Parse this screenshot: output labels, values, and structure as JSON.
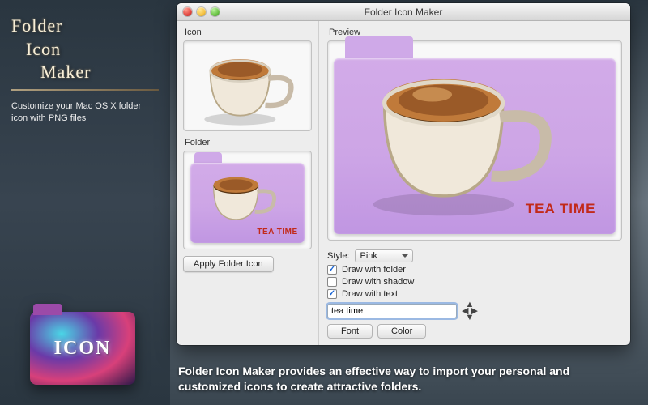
{
  "sidebar": {
    "title_line1": "Folder",
    "title_line2": "Icon",
    "title_line3": "Maker",
    "tagline": "Customize your Mac OS X folder icon with PNG files",
    "dock_label": "ICON"
  },
  "window": {
    "title": "Folder Icon Maker",
    "labels": {
      "icon": "Icon",
      "folder": "Folder",
      "preview": "Preview",
      "style": "Style:"
    },
    "apply_button": "Apply Folder Icon",
    "folder_text_small": "TEA TIME",
    "preview_text": "TEA TIME",
    "style_value": "Pink",
    "options": {
      "draw_folder": {
        "label": "Draw with folder",
        "checked": true
      },
      "draw_shadow": {
        "label": "Draw with shadow",
        "checked": false
      },
      "draw_text": {
        "label": "Draw with text",
        "checked": true
      }
    },
    "text_input": "tea time",
    "buttons": {
      "font": "Font",
      "color": "Color"
    }
  },
  "caption": "Folder Icon Maker provides an effective way to import your personal and customized icons to create attractive folders."
}
